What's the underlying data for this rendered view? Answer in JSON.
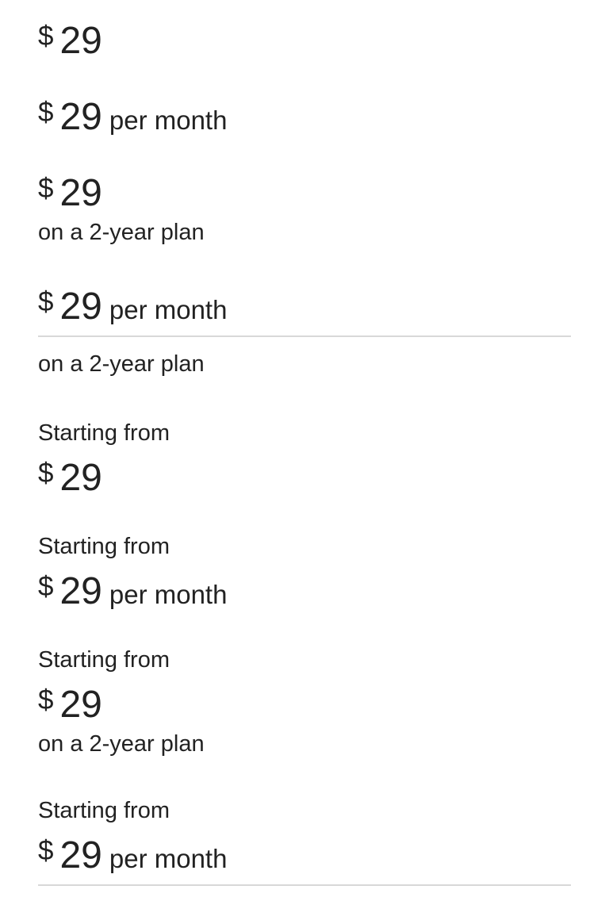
{
  "currency_symbol": "$",
  "amount": "29",
  "period": "per month",
  "plan_caption": "on a 2-year plan",
  "eyebrow": "Starting from",
  "variants": [
    {
      "name": "price-only"
    },
    {
      "name": "price-per-month"
    },
    {
      "name": "price-with-caption"
    },
    {
      "name": "price-per-month-divider-caption"
    },
    {
      "name": "starting-from-price"
    },
    {
      "name": "starting-from-price-per-month"
    },
    {
      "name": "starting-from-price-caption"
    },
    {
      "name": "starting-from-price-per-month-divider"
    }
  ],
  "colors": {
    "text": "#222222",
    "divider": "#d8d8d8",
    "background": "#ffffff"
  }
}
